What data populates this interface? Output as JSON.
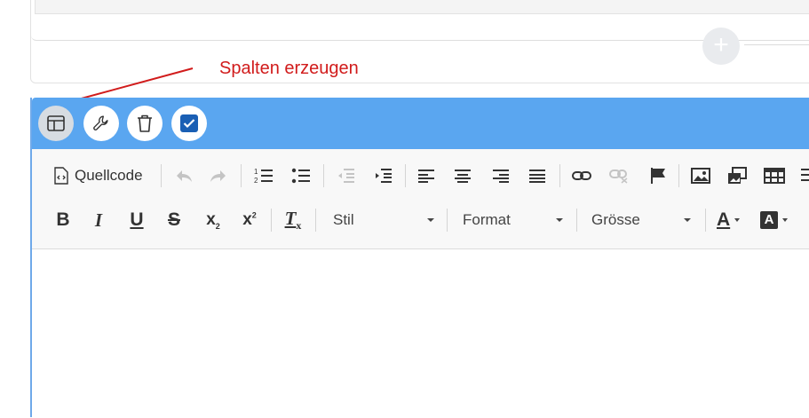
{
  "annotation": {
    "text": "Spalten erzeugen",
    "color": "#d11b1b"
  },
  "top_card": {
    "add_button_label": "+"
  },
  "block_toolbar": {
    "accent": "#5aa6f0",
    "buttons": [
      {
        "name": "columns-layout-icon"
      },
      {
        "name": "wrench-icon"
      },
      {
        "name": "trash-icon"
      },
      {
        "name": "checkbox-icon",
        "checked": true
      }
    ]
  },
  "editor": {
    "source_label": "Quellcode",
    "combos": {
      "style": "Stil",
      "format": "Format",
      "size": "Grösse"
    },
    "formatting": {
      "bold": "B",
      "italic": "I",
      "underline": "U",
      "strike": "S",
      "subscript": "x",
      "sub_mark": "2",
      "superscript": "x",
      "sup_mark": "2",
      "remove_format": "T",
      "remove_mark": "x",
      "text_color": "A",
      "bg_color": "A"
    }
  }
}
